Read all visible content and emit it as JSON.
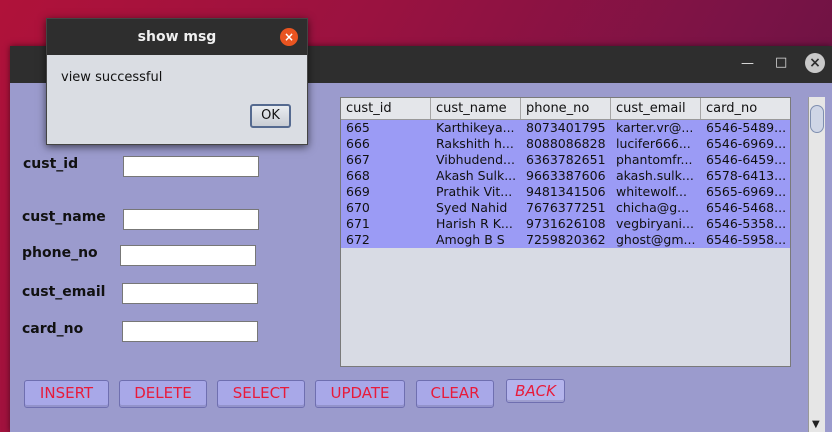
{
  "dialog": {
    "title": "show msg",
    "message": "view successful",
    "ok_label": "OK"
  },
  "window": {
    "min_glyph": "—",
    "max_glyph": "□",
    "close_glyph": "×"
  },
  "form": {
    "cust_id_label": "cust_id",
    "cust_name_label": "cust_name",
    "phone_no_label": "phone_no",
    "cust_email_label": "cust_email",
    "card_no_label": "card_no"
  },
  "table": {
    "columns": [
      "cust_id",
      "cust_name",
      "phone_no",
      "cust_email",
      "card_no"
    ],
    "rows": [
      [
        "665",
        "Karthikeya...",
        "8073401795",
        "karter.vr@...",
        "6546-5489..."
      ],
      [
        "666",
        "Rakshith h...",
        "8088086828",
        "lucifer666...",
        "6546-6969..."
      ],
      [
        "667",
        "Vibhudend...",
        "6363782651",
        "phantomfr...",
        "6546-6459..."
      ],
      [
        "668",
        "Akash Sulk...",
        "9663387606",
        "akash.sulk...",
        "6578-6413..."
      ],
      [
        "669",
        "Prathik Vit...",
        "9481341506",
        "whitewolf...",
        "6565-6969..."
      ],
      [
        "670",
        "Syed Nahid",
        "7676377251",
        "chicha@g...",
        "6546-5468..."
      ],
      [
        "671",
        "Harish R K...",
        "9731626108",
        "vegbiryani...",
        "6546-5358..."
      ],
      [
        "672",
        "Amogh B S",
        "7259820362",
        "ghost@gm...",
        "6546-5958..."
      ]
    ]
  },
  "buttons": {
    "insert": "INSERT",
    "delete": "DELETE",
    "select": "SELECT",
    "update": "UPDATE",
    "clear": "CLEAR",
    "back": "BACK"
  },
  "colors": {
    "panel": "#9b9bcd",
    "row_highlight": "#9b9bf5",
    "button_text": "#e81a3a"
  }
}
